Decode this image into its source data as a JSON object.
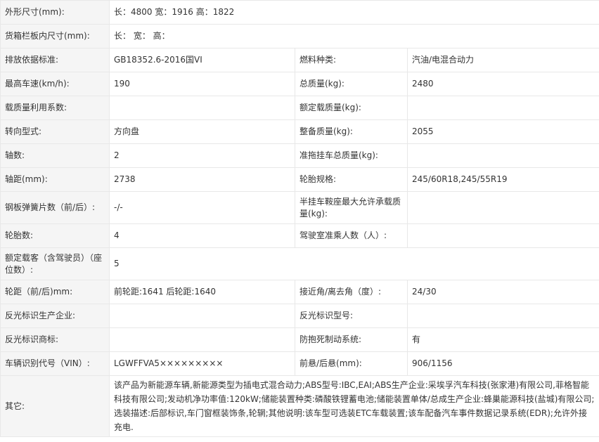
{
  "rows": [
    {
      "k1": "外形尺寸(mm):",
      "v1": "长：4800 宽：1916 高：1822",
      "wide": true
    },
    {
      "k1": "货箱栏板内尺寸(mm):",
      "v1": "长： 宽： 高：",
      "wide": true
    },
    {
      "k1": "排放依据标准:",
      "v1": "GB18352.6-2016国VI",
      "k2": "燃料种类:",
      "v2": "汽油/电混合动力"
    },
    {
      "k1": "最高车速(km/h):",
      "v1": "190",
      "k2": "总质量(kg):",
      "v2": "2480"
    },
    {
      "k1": "载质量利用系数:",
      "v1": "",
      "k2": "额定载质量(kg):",
      "v2": ""
    },
    {
      "k1": "转向型式:",
      "v1": "方向盘",
      "k2": "整备质量(kg):",
      "v2": "2055"
    },
    {
      "k1": "轴数:",
      "v1": "2",
      "k2": "准拖挂车总质量(kg):",
      "v2": ""
    },
    {
      "k1": "轴距(mm):",
      "v1": "2738",
      "k2": "轮胎规格:",
      "v2": "245/60R18,245/55R19"
    },
    {
      "k1": "钢板弹簧片数（前/后）:",
      "v1": "-/-",
      "k2": "半挂车鞍座最大允许承载质量(kg):",
      "v2": ""
    },
    {
      "k1": "轮胎数:",
      "v1": "4",
      "k2": "驾驶室准乘人数（人）:",
      "v2": ""
    },
    {
      "k1": "额定载客（含驾驶员）（座位数）:",
      "v1": "5",
      "wide": true
    },
    {
      "k1": "轮距（前/后)mm:",
      "v1": "前轮距:1641 后轮距:1640",
      "k2": "接近角/离去角（度）:",
      "v2": "24/30"
    },
    {
      "k1": "反光标识生产企业:",
      "v1": "",
      "k2": "反光标识型号:",
      "v2": ""
    },
    {
      "k1": "反光标识商标:",
      "v1": "",
      "k2": "防抱死制动系统:",
      "v2": "有"
    },
    {
      "k1": "车辆识别代号（VIN）:",
      "v1": "LGWFFVA5×××××××××",
      "k2": "前悬/后悬(mm):",
      "v2": "906/1156"
    }
  ],
  "other": {
    "label": "其它:",
    "text": "该产品为新能源车辆,新能源类型为插电式混合动力;ABS型号:IBC,EAI;ABS生产企业:采埃孚汽车科技(张家港)有限公司,菲格智能科技有限公司;发动机净功率值:120kW;储能装置种类:磷酸铁锂蓄电池;储能装置单体/总成生产企业:蜂巢能源科技(盐城)有限公司;选装描述:后部标识,车门窗框装饰条,轮辋;其他说明:该车型可选装ETC车载装置;该车配备汽车事件数据记录系统(EDR);允许外接充电."
  }
}
